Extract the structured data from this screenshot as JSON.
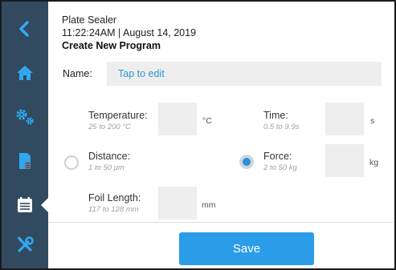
{
  "sidebar": {
    "items": [
      {
        "icon": "back-chevron-icon"
      },
      {
        "icon": "home-icon"
      },
      {
        "icon": "gears-icon"
      },
      {
        "icon": "document-icon"
      },
      {
        "icon": "program-list-icon",
        "active": true
      },
      {
        "icon": "tools-icon"
      }
    ]
  },
  "header": {
    "device": "Plate Sealer",
    "datetime": "11:22:24AM | August 14, 2019",
    "page_title": "Create New Program"
  },
  "name": {
    "label": "Name:",
    "placeholder": "Tap to edit"
  },
  "fields": {
    "temperature": {
      "label": "Temperature:",
      "hint": "25 to 200 °C",
      "unit": "°C",
      "value": ""
    },
    "time": {
      "label": "Time:",
      "hint": "0.5 to 9.9s",
      "unit": "s",
      "value": ""
    },
    "distance": {
      "label": "Distance:",
      "hint": "1 to 50 μm",
      "selected": false
    },
    "force": {
      "label": "Force:",
      "hint": "2 to 50 kg",
      "unit": "kg",
      "value": "",
      "selected": true
    },
    "foil_length": {
      "label": "Foil Length:",
      "hint": "117 to 128 mm",
      "unit": "mm",
      "value": ""
    }
  },
  "actions": {
    "save_label": "Save"
  },
  "colors": {
    "sidebar": "#324a5f",
    "accent": "#2b9de8",
    "input_bg": "#eeeeee"
  }
}
